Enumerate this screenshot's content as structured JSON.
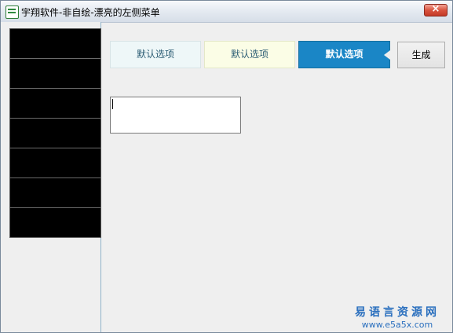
{
  "window": {
    "title": "宇翔软件-非自绘-漂亮的左侧菜单",
    "close_label": "×"
  },
  "sidebar": {
    "items": [
      "",
      "",
      "",
      "",
      "",
      "",
      ""
    ]
  },
  "tabs": [
    {
      "label": "默认选项",
      "state": "normal"
    },
    {
      "label": "默认选项",
      "state": "hover"
    },
    {
      "label": "默认选项",
      "state": "selected"
    }
  ],
  "generate_button": {
    "label": "生成"
  },
  "text_input": {
    "value": ""
  },
  "watermark": {
    "name": "易语言资源网",
    "url": "www.e5a5x.com"
  },
  "colors": {
    "selected_tab": "#1a86c6",
    "menu_item": "#000000",
    "watermark": "#2a6fbe"
  }
}
